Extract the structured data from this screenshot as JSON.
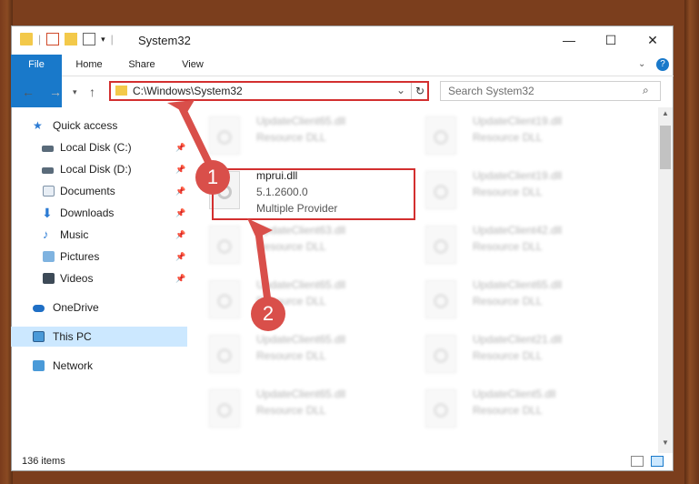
{
  "window": {
    "title": "System32"
  },
  "ribbon": {
    "tabs": [
      "File",
      "Home",
      "Share",
      "View"
    ]
  },
  "address": {
    "path": "C:\\Windows\\System32"
  },
  "search": {
    "placeholder": "Search System32"
  },
  "nav": {
    "quick_access": "Quick access",
    "items": [
      {
        "label": "Local Disk (C:)",
        "icon": "drive-icon"
      },
      {
        "label": "Local Disk (D:)",
        "icon": "drive-icon"
      },
      {
        "label": "Documents",
        "icon": "documents-icon"
      },
      {
        "label": "Downloads",
        "icon": "downloads-icon"
      },
      {
        "label": "Music",
        "icon": "music-icon"
      },
      {
        "label": "Pictures",
        "icon": "pictures-icon"
      },
      {
        "label": "Videos",
        "icon": "videos-icon"
      }
    ],
    "onedrive": "OneDrive",
    "this_pc": "This PC",
    "network": "Network"
  },
  "files": {
    "selected": {
      "name": "mprui.dll",
      "version": "5.1.2600.0",
      "desc": "Multiple Provider"
    },
    "left": [
      {
        "name": "UpdateClient65.dll",
        "type": "Resource DLL"
      },
      {
        "name": "UpdateClient63.dll",
        "type": "Resource DLL"
      },
      {
        "name": "UpdateClient65.dll",
        "type": "Resource DLL"
      },
      {
        "name": "UpdateClient65.dll",
        "type": "Resource DLL"
      },
      {
        "name": "UpdateClient65.dll",
        "type": "Resource DLL"
      }
    ],
    "right": [
      {
        "name": "UpdateClient19.dll",
        "type": "Resource DLL"
      },
      {
        "name": "UpdateClient19.dll",
        "type": "Resource DLL"
      },
      {
        "name": "UpdateClient42.dll",
        "type": "Resource DLL"
      },
      {
        "name": "UpdateClient65.dll",
        "type": "Resource DLL"
      },
      {
        "name": "UpdateClient21.dll",
        "type": "Resource DLL"
      },
      {
        "name": "UpdateClient5.dll",
        "type": "Resource DLL"
      }
    ]
  },
  "status": {
    "count": "136 items"
  },
  "steps": {
    "one": "1",
    "two": "2"
  },
  "colors": {
    "accent": "#1979ca",
    "highlight": "#d32f2f",
    "badge": "#d94f4a"
  }
}
